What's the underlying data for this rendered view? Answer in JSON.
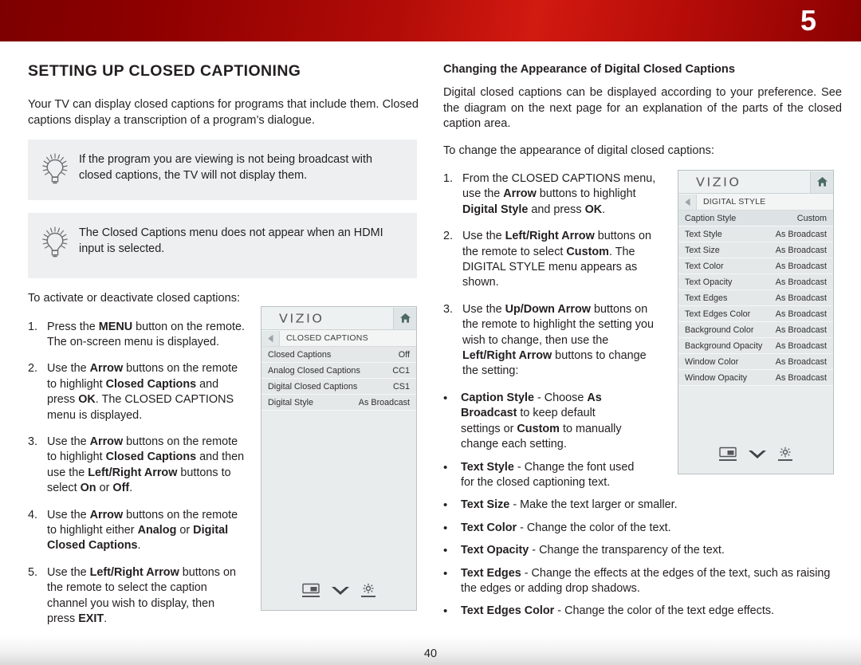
{
  "header": {
    "chapter_number": "5",
    "accent_color": "#b20c08"
  },
  "footer": {
    "page_number": "40"
  },
  "left_column": {
    "section_title": "SETTING UP CLOSED CAPTIONING",
    "intro": "Your TV can display closed captions for programs that include them. Closed captions display a transcription of a program’s dialogue.",
    "tips": [
      {
        "icon": "lightbulb-icon",
        "text": "If the program you are viewing is not being broadcast with closed captions, the TV will not display them."
      },
      {
        "icon": "lightbulb-icon",
        "text": "The Closed Captions menu does not appear when an HDMI input is selected."
      }
    ],
    "lead_in": "To activate or deactivate closed captions:",
    "steps": [
      {
        "number": "1.",
        "html": "Press the <b>MENU</b> button on the remote. The on-screen menu is displayed."
      },
      {
        "number": "2.",
        "html": "Use the <b>Arrow</b> buttons on the remote to highlight <b>Closed Captions</b> and press <b>OK</b>. The CLOSED CAPTIONS menu is displayed."
      },
      {
        "number": "3.",
        "html": "Use the <b>Arrow</b> buttons on the remote to highlight <b>Closed Captions</b> and then use the <b>Left/Right Arrow</b> buttons to select <b>On</b> or <b>Off</b>."
      },
      {
        "number": "4.",
        "html": "Use the <b>Arrow</b> buttons on the remote to highlight either <b>Analog</b> or <b>Digital Closed Captions</b>."
      },
      {
        "number": "5.",
        "html": "Use the <b>Left/Right Arrow</b> buttons on the remote to select the caption channel you wish to display, then press <b>EXIT</b>."
      }
    ]
  },
  "right_column": {
    "sub_title": "Changing the Appearance of Digital Closed Captions",
    "intro": "Digital closed captions can be displayed according to your preference. See the diagram on the next page for an explanation of the parts of the closed caption area.",
    "lead_in": "To change the appearance of digital closed captions:",
    "steps": [
      {
        "number": "1.",
        "html": "From the CLOSED CAPTIONS menu, use the <b>Arrow</b> buttons to highlight <b>Digital Style</b> and press <b>OK</b>."
      },
      {
        "number": "2.",
        "html": "Use the <b>Left/Right Arrow</b> buttons on the remote to select <b>Custom</b>. The DIGITAL STYLE menu appears as shown."
      },
      {
        "number": "3.",
        "html": "Use the <b>Up/Down Arrow</b> buttons on the remote to highlight the setting you wish to change, then use the <b>Left/Right Arrow</b> buttons to change the setting:"
      }
    ],
    "bullets": [
      {
        "marker": "•",
        "html": "<b>Caption Style</b> - Choose <b>As Broadcast</b> to keep default settings or <b>Custom</b> to manually change each setting."
      },
      {
        "marker": "•",
        "html": "<b>Text Style</b>  - Change the font used for the closed captioning text."
      },
      {
        "marker": "•",
        "html": "<b>Text Size</b> - Make the text larger or smaller."
      },
      {
        "marker": "•",
        "html": "<b>Text Color</b> - Change the color of the text."
      },
      {
        "marker": "•",
        "html": "<b>Text Opacity</b> - Change the transparency of the text."
      },
      {
        "marker": "•",
        "html": "<b>Text Edges</b> - Change the effects at the edges of the text, such as raising the edges or adding drop shadows."
      },
      {
        "marker": "•",
        "html": "<b>Text Edges Color</b> - Change the color of the text edge effects."
      }
    ]
  },
  "osd_closed_captions": {
    "brand": "VIZIO",
    "home_icon": "home-icon",
    "back_icon": "back-arrow-icon",
    "breadcrumb": "CLOSED CAPTIONS",
    "rows": [
      {
        "label": "Closed Captions",
        "value": "Off"
      },
      {
        "label": "Analog Closed Captions",
        "value": "CC1"
      },
      {
        "label": "Digital Closed Captions",
        "value": "CS1"
      },
      {
        "label": "Digital Style",
        "value": "As Broadcast"
      }
    ],
    "footer_icons": [
      "picture-mode-icon",
      "chevron-down-icon",
      "settings-gear-icon"
    ]
  },
  "osd_digital_style": {
    "brand": "VIZIO",
    "home_icon": "home-icon",
    "back_icon": "back-arrow-icon",
    "breadcrumb": "DIGITAL STYLE",
    "rows": [
      {
        "label": "Caption Style",
        "value": "Custom",
        "highlighted": true
      },
      {
        "label": "Text Style",
        "value": "As Broadcast"
      },
      {
        "label": "Text Size",
        "value": "As Broadcast"
      },
      {
        "label": "Text Color",
        "value": "As Broadcast"
      },
      {
        "label": "Text Opacity",
        "value": "As Broadcast"
      },
      {
        "label": "Text Edges",
        "value": "As Broadcast"
      },
      {
        "label": "Text Edges Color",
        "value": "As Broadcast"
      },
      {
        "label": "Background Color",
        "value": "As Broadcast"
      },
      {
        "label": "Background Opacity",
        "value": "As Broadcast"
      },
      {
        "label": "Window Color",
        "value": "As Broadcast"
      },
      {
        "label": "Window Opacity",
        "value": "As Broadcast"
      }
    ],
    "footer_icons": [
      "picture-mode-icon",
      "chevron-down-icon",
      "settings-gear-icon"
    ]
  }
}
